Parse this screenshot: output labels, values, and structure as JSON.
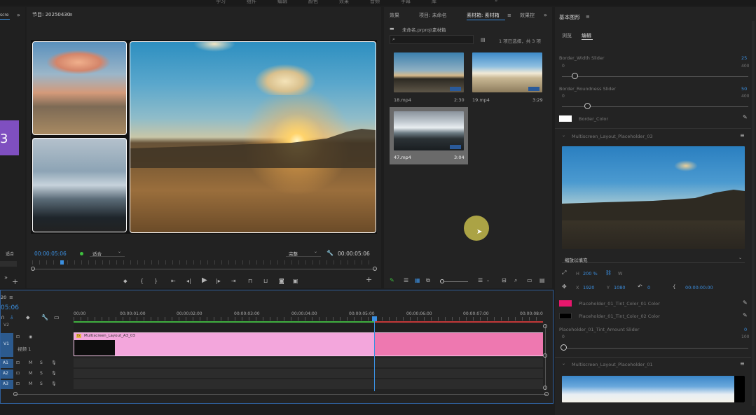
{
  "menu": {
    "items": [
      "学习",
      "组件",
      "编辑",
      "颜色",
      "效果",
      "音频",
      "字幕",
      "库"
    ]
  },
  "left_sliver": {
    "tab": "scre",
    "badge": "3",
    "fit": "适合"
  },
  "program_monitor": {
    "title": "节目: 20250430",
    "timecode_left": "00:00:05:06",
    "fit": "适合",
    "quality": "完整",
    "timecode_right": "00:00:05:06"
  },
  "project_panel": {
    "tabs": [
      "效果",
      "项目: 未命名",
      "素材箱: 素材箱",
      "效果控"
    ],
    "bin_path": "未命名.prproj\\素材箱",
    "search_placeholder": "",
    "selection_status": "1 项已选择，共 3 项",
    "clips": [
      {
        "name": "18.mp4",
        "duration": "2:30"
      },
      {
        "name": "19.mp4",
        "duration": "3:29"
      },
      {
        "name": "47.mp4",
        "duration": "3:04"
      }
    ]
  },
  "essential_graphics": {
    "title": "基本图形",
    "tabs": [
      "浏览",
      "编辑"
    ],
    "border_width": {
      "label": "Border_Width Slider",
      "value": "25",
      "min": "0",
      "max": "400",
      "level": 0.06
    },
    "border_roundness": {
      "label": "Border_Roundness Slider",
      "value": "50",
      "min": "0",
      "max": "400",
      "level": 0.12
    },
    "border_color": {
      "label": "Border_Color",
      "swatch": "#ffffff"
    },
    "placeholder_03": {
      "label": "Multiscreen_Layout_Placeholder_03"
    },
    "fill_mode": "缩放以填充",
    "transform": {
      "h_label": "H",
      "h_value": "200 %",
      "w_label": "W",
      "x_label": "X",
      "x_value": "1920",
      "y_label": "Y",
      "y_value": "1080",
      "rotation": "0",
      "timecode": "00:00:00:00"
    },
    "tint_color_01": {
      "label": "Placeholder_01_Tint_Color_01 Color",
      "swatch": "#e8176d"
    },
    "tint_color_02": {
      "label": "Placeholder_01_Tint_Color_02 Color",
      "swatch": "#000000"
    },
    "tint_amount": {
      "label": "Placeholder_01_Tint_Amount Slider",
      "value": "0",
      "min": "0",
      "max": "100",
      "level": 0.0
    },
    "placeholder_01": {
      "label": "Multiscreen_Layout_Placeholder_01"
    }
  },
  "timeline": {
    "sequence_tab": "20",
    "timecode": "05:06",
    "ruler": [
      "00:00",
      "00:00:01:00",
      "00:00:02:00",
      "00:00:03:00",
      "00:00:04:00",
      "00:00:05:00",
      "00:00:06:00",
      "00:00:07:00",
      "00:00:08:0"
    ],
    "tracks": {
      "v2": "V2",
      "v1": "V1",
      "v1_name": "视频 1",
      "a1": "A1",
      "a2": "A2",
      "a3": "A3"
    },
    "clip_label": "Multiscreen_Layout_A3_03",
    "clip_badge": "fx",
    "track_btns": {
      "lock": "⊡",
      "mute": "M",
      "solo": "S"
    }
  },
  "colors": {
    "accent_blue": "#3b8fe0",
    "clip_pink": "#f3a6dc",
    "clip_pink_selected": "#ee78b0",
    "playhead": "#3b8fe0"
  }
}
